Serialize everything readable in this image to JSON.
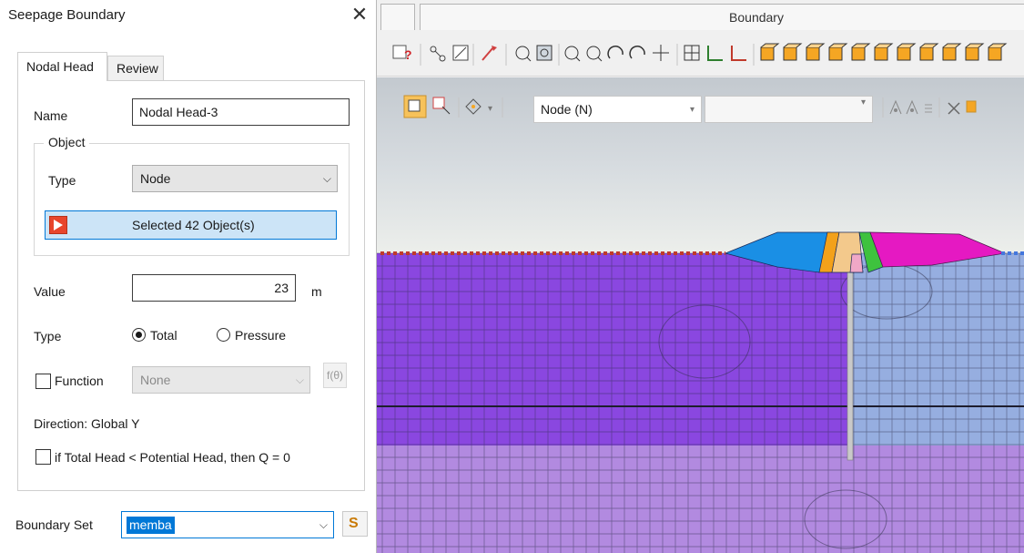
{
  "dialog": {
    "title": "Seepage Boundary",
    "close_glyph": "✕",
    "tabs": [
      {
        "label": "Nodal Head",
        "active": true
      },
      {
        "label": "Review",
        "active": false
      }
    ],
    "name_label": "Name",
    "name_value": "Nodal Head-3",
    "object_group_label": "Object",
    "object_type_label": "Type",
    "object_type_value": "Node",
    "select_button_label": "Selected 42 Object(s)",
    "value_label": "Value",
    "value": "23",
    "value_unit": "m",
    "head_type_label": "Type",
    "head_type_options": [
      {
        "label": "Total",
        "selected": true
      },
      {
        "label": "Pressure",
        "selected": false
      }
    ],
    "function_label": "Function",
    "function_checked": false,
    "function_value": "None",
    "direction_text": "Direction: Global Y",
    "q_condition_label": "if Total Head < Potential Head, then Q = 0",
    "q_condition_checked": false,
    "boundary_set_label": "Boundary Set",
    "boundary_set_value": "memba"
  },
  "app": {
    "doc_tab_title": "Boundary",
    "selection_filter_value": "Node (N)",
    "secondary_filter_value": "",
    "colors": {
      "accent": "#0078d7",
      "soil_left": "#8a47e0",
      "soil_right": "#96aee0",
      "soil_bottom": "#b28ae0",
      "embankment_blue": "#1a8fe5",
      "embankment_magenta": "#e519c2",
      "boundary_red": "#c0392b",
      "boundary_blue": "#4477dd"
    }
  }
}
